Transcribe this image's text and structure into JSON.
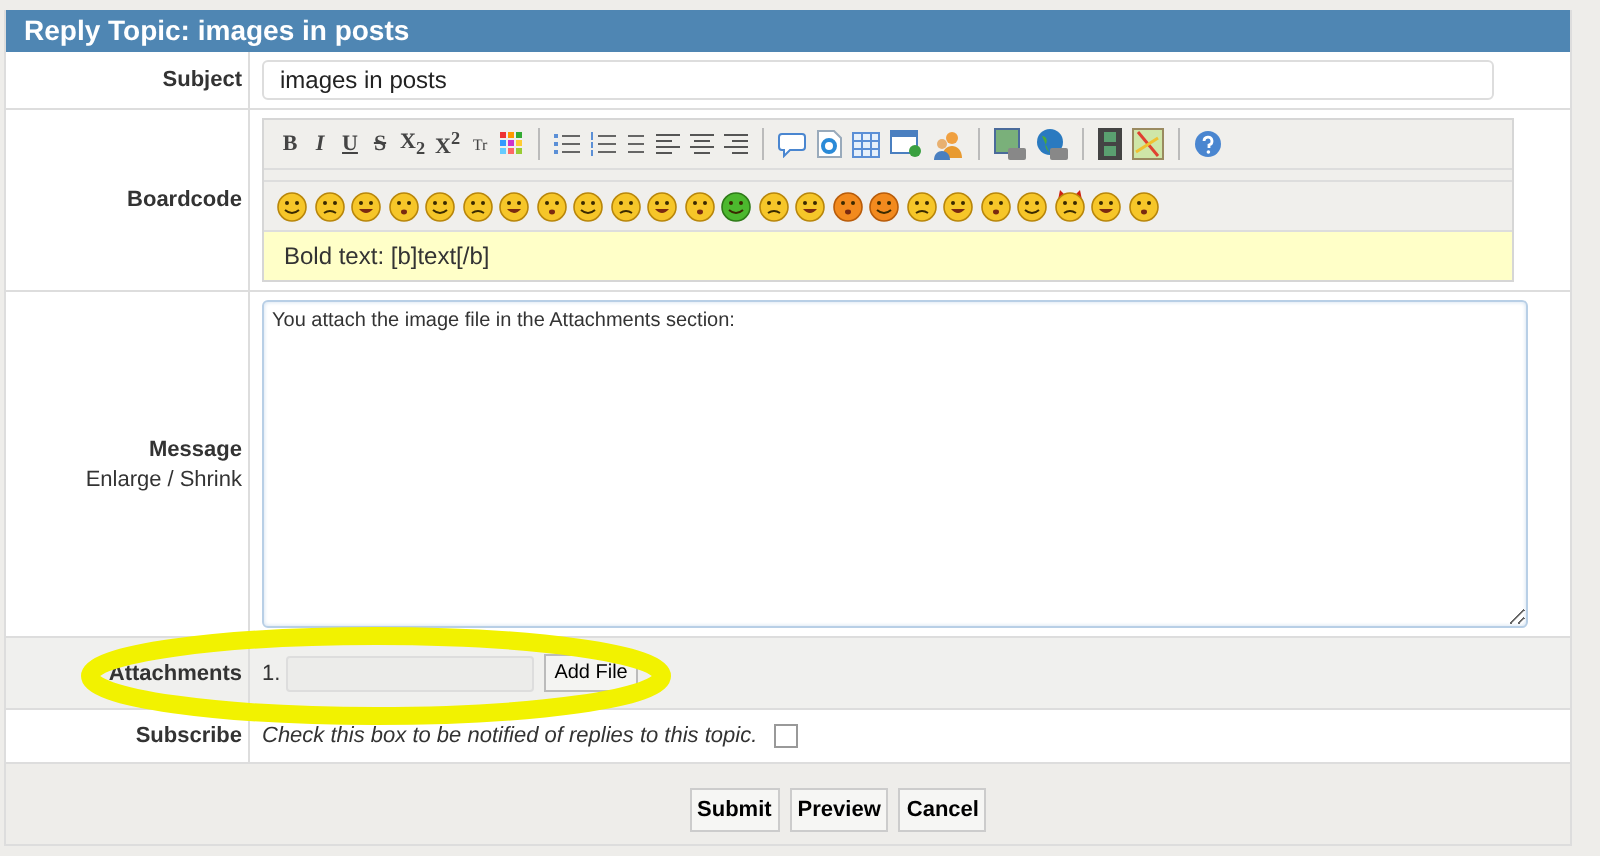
{
  "title": "Reply Topic: images in posts",
  "subject": {
    "label": "Subject",
    "value": "images in posts"
  },
  "boardcode": {
    "label": "Boardcode",
    "format_buttons": [
      {
        "label": "B",
        "kind": "bold"
      },
      {
        "label": "I",
        "kind": "italic"
      },
      {
        "label": "U",
        "kind": "underline"
      },
      {
        "label": "S",
        "kind": "strike"
      },
      {
        "label": "X$_{2}$",
        "kind": "sub"
      },
      {
        "label": "X$^{2}$",
        "kind": "sup"
      },
      {
        "label": "Tr",
        "kind": "font"
      }
    ],
    "hint": "Bold text: [b]text[/b]"
  },
  "message": {
    "label": "Message",
    "enlarge": "Enlarge",
    "separator": "/",
    "shrink": "Shrink",
    "value": "You attach the image file in the Attachments section:"
  },
  "attachments": {
    "label": "Attachments",
    "items": [
      {
        "number": "1."
      }
    ],
    "button": "Add File"
  },
  "subscribe": {
    "label": "Subscribe",
    "text": "Check this box to be notified of replies to this topic.",
    "checked": false
  },
  "buttons": [
    "Submit",
    "Preview",
    "Cancel"
  ]
}
